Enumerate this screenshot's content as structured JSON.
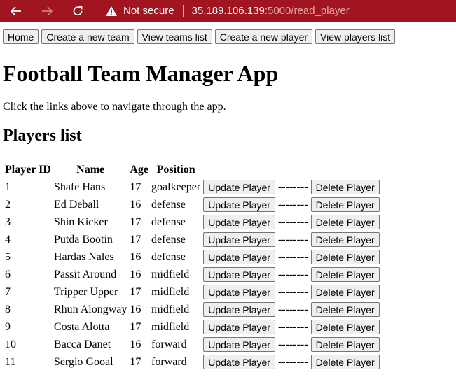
{
  "browser": {
    "security_label": "Not secure",
    "url_host": "35.189.106.139",
    "url_rest": ":5000/read_player"
  },
  "nav": {
    "home": "Home",
    "create_team": "Create a new team",
    "view_teams": "View teams list",
    "create_player": "Create a new player",
    "view_players": "View players list"
  },
  "page": {
    "title": "Football Team Manager App",
    "intro": "Click the links above to navigate through the app.",
    "section_title": "Players list"
  },
  "table": {
    "headers": [
      "Player ID",
      "Name",
      "Age",
      "Position"
    ],
    "update_label": "Update Player",
    "separator": "--------",
    "delete_label": "Delete Player",
    "rows": [
      {
        "id": "1",
        "name": "Shafe Hans",
        "age": "17",
        "position": "goalkeeper"
      },
      {
        "id": "2",
        "name": "Ed Deball",
        "age": "16",
        "position": "defense"
      },
      {
        "id": "3",
        "name": "Shin Kicker",
        "age": "17",
        "position": "defense"
      },
      {
        "id": "4",
        "name": "Putda Bootin",
        "age": "17",
        "position": "defense"
      },
      {
        "id": "5",
        "name": "Hardas Nales",
        "age": "16",
        "position": "defense"
      },
      {
        "id": "6",
        "name": "Passit Around",
        "age": "16",
        "position": "midfield"
      },
      {
        "id": "7",
        "name": "Tripper Upper",
        "age": "17",
        "position": "midfield"
      },
      {
        "id": "8",
        "name": "Rhun Alongway",
        "age": "16",
        "position": "midfield"
      },
      {
        "id": "9",
        "name": "Costa Alotta",
        "age": "17",
        "position": "midfield"
      },
      {
        "id": "10",
        "name": "Bacca Danet",
        "age": "16",
        "position": "forward"
      },
      {
        "id": "11",
        "name": "Sergio Gooal",
        "age": "17",
        "position": "forward"
      }
    ]
  }
}
